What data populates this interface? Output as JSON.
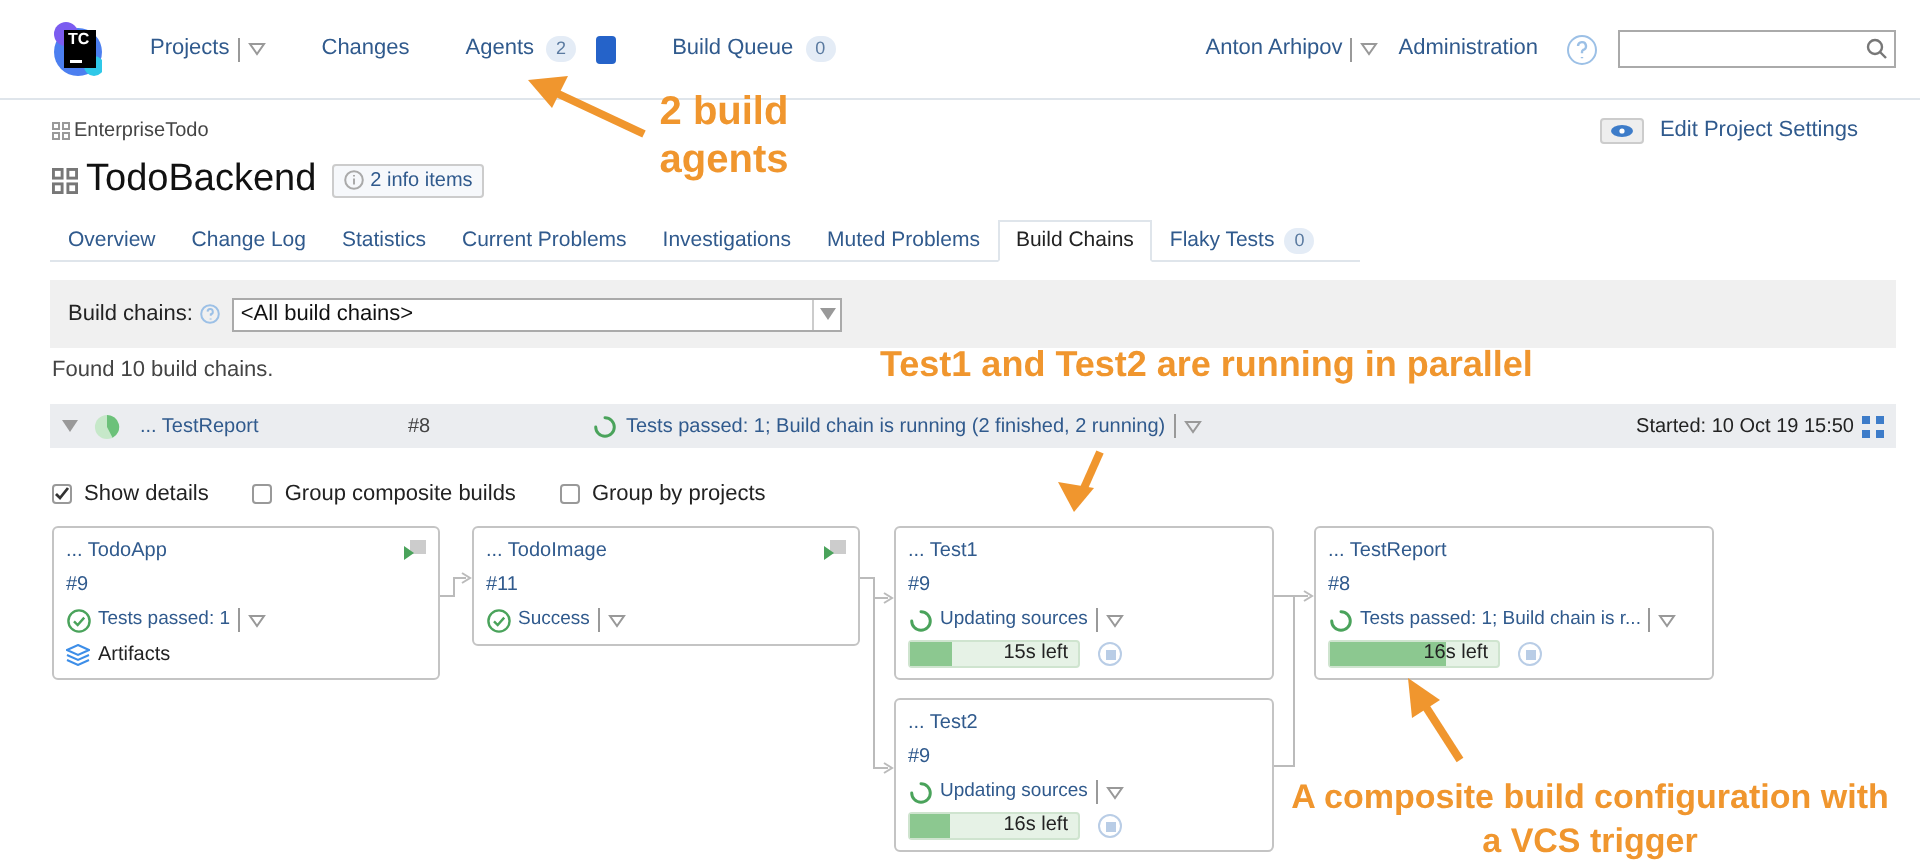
{
  "header": {
    "logo": "TC",
    "nav": [
      {
        "label": "Projects",
        "dropdown": true
      },
      {
        "label": "Changes"
      },
      {
        "label": "Agents",
        "badge": "2",
        "agent_marker": true
      },
      {
        "label": "Build Queue",
        "badge": "0"
      }
    ],
    "user": "Anton Arhipov",
    "admin": "Administration"
  },
  "breadcrumb": "EnterpriseTodo",
  "edit_settings": "Edit Project Settings",
  "project": {
    "title": "TodoBackend",
    "info": "2 info items"
  },
  "tabs": [
    {
      "label": "Overview",
      "selected": false
    },
    {
      "label": "Change Log",
      "selected": false
    },
    {
      "label": "Statistics",
      "selected": false
    },
    {
      "label": "Current Problems",
      "selected": false
    },
    {
      "label": "Investigations",
      "selected": false
    },
    {
      "label": "Muted Problems",
      "selected": false
    },
    {
      "label": "Build Chains",
      "selected": true
    },
    {
      "label": "Flaky Tests",
      "selected": false,
      "badge": "0"
    }
  ],
  "filter": {
    "label": "Build chains:",
    "value": "<All build chains>"
  },
  "found": "Found 10 build chains.",
  "chain": {
    "name": "... TestReport",
    "number": "#8",
    "status": "Tests passed: 1; Build chain is running (2 finished, 2 running)",
    "started": "Started: 10 Oct 19 15:50"
  },
  "options": [
    {
      "label": "Show details",
      "checked": true
    },
    {
      "label": "Group composite builds",
      "checked": false
    },
    {
      "label": "Group by projects",
      "checked": false
    }
  ],
  "nodes": [
    {
      "name": "... TodoApp",
      "number": "#9",
      "kind": "finished",
      "status": "Tests passed: 1",
      "artifacts": "Artifacts",
      "run_button": true
    },
    {
      "name": "... TodoImage",
      "number": "#11",
      "kind": "finished",
      "status": "Success",
      "run_button": true
    },
    {
      "name": "... Test1",
      "number": "#9",
      "kind": "running",
      "status": "Updating sources",
      "level": 0.25,
      "time_left": "15s left"
    },
    {
      "name": "... Test2",
      "number": "#9",
      "kind": "running",
      "status": "Updating sources",
      "level": 0.24,
      "time_left": "16s left"
    },
    {
      "name": "... TestReport",
      "number": "#8",
      "kind": "running",
      "status": "Tests passed: 1; Build chain is r...",
      "level": 0.69,
      "time_left": "16s left"
    }
  ],
  "annotations": [
    {
      "text": "2 build agents"
    },
    {
      "text": "Test1 and Test2 are running in parallel"
    },
    {
      "text": "A composite build configuration with a VCS trigger"
    }
  ]
}
